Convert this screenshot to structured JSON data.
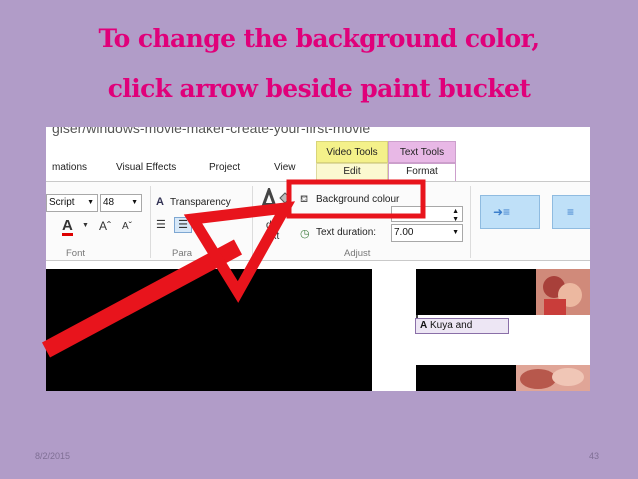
{
  "slide": {
    "title_line1": "To change the background color,",
    "title_line2": "click arrow beside paint bucket",
    "date": "8/2/2015",
    "page_number": "43"
  },
  "screenshot": {
    "url_text": "giser/windows-movie-maker-create-your-first-movie",
    "tabs": [
      "mations",
      "Visual Effects",
      "Project",
      "View"
    ],
    "contextual": {
      "video_tools": "Video Tools",
      "text_tools": "Text Tools",
      "edit": "Edit",
      "format": "Format"
    },
    "font": {
      "name": "Script",
      "size": "48",
      "group_label": "Font"
    },
    "paragraph": {
      "transparency_label": "Transparency",
      "group_label": "Para"
    },
    "edit_text": {
      "line1": "dit",
      "line2": "ext"
    },
    "adjust": {
      "background_colour_label": "Background colour",
      "text_duration_label": "Text duration:",
      "text_duration_value": "7.00",
      "group_label": "Adjust"
    },
    "caption_text": "Kuya and",
    "icon_glyphs": {
      "font_color": "A",
      "caption_a": "A",
      "transparency": "A"
    }
  },
  "annotation": {
    "arrow_color": "#e8141c",
    "highlight_color": "#e8141c"
  },
  "colors": {
    "background": "#b19cc8",
    "title": "#e0007a"
  }
}
